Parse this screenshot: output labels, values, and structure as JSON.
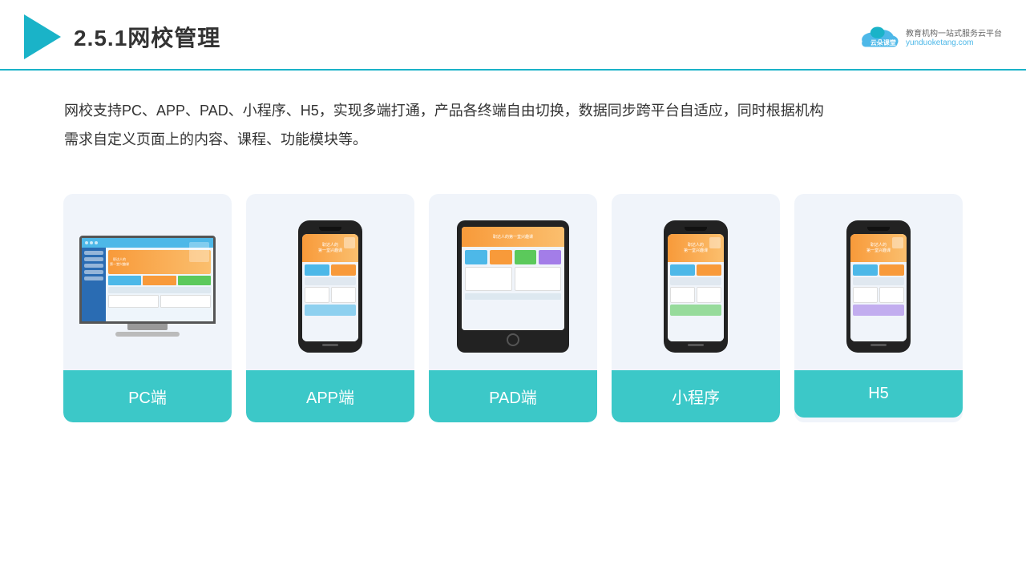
{
  "header": {
    "title": "2.5.1网校管理",
    "brand_name": "云朵课堂",
    "brand_tagline": "教育机构一站式服务云平台",
    "brand_url": "yunduoketang.com"
  },
  "description": {
    "text1": "网校支持PC、APP、PAD、小程序、H5，实现多端打通，产品各终端自由切换，数据同步跨平台自适应，同时根据机构",
    "text2": "需求自定义页面上的内容、课程、功能模块等。"
  },
  "cards": [
    {
      "label": "PC端",
      "type": "pc"
    },
    {
      "label": "APP端",
      "type": "phone"
    },
    {
      "label": "PAD端",
      "type": "tablet"
    },
    {
      "label": "小程序",
      "type": "phone"
    },
    {
      "label": "H5",
      "type": "phone"
    }
  ],
  "colors": {
    "accent": "#3cc8c8",
    "header_border": "#1ab3c8",
    "triangle": "#1ab3c8"
  }
}
